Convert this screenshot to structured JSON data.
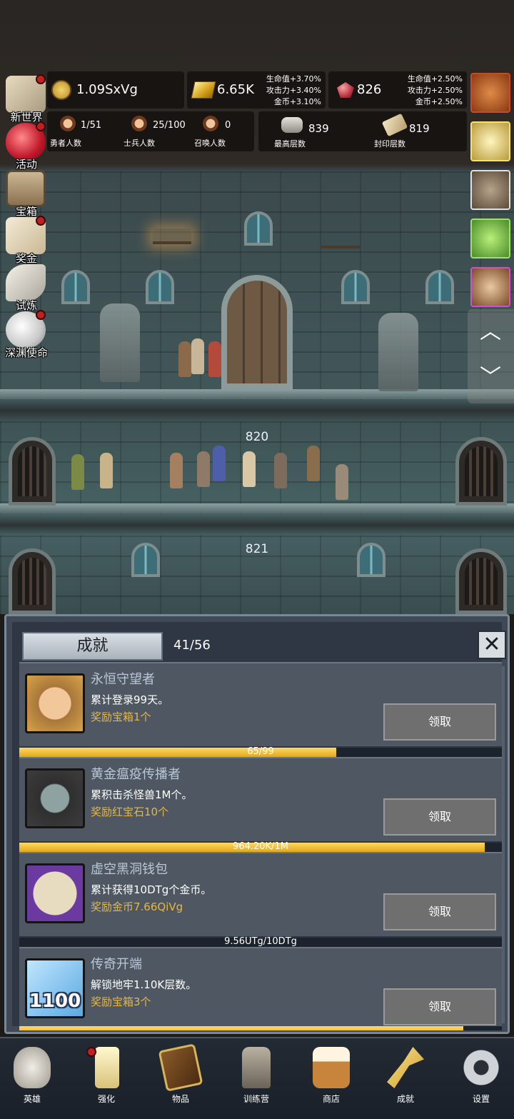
{
  "hud": {
    "coins": "1.09SxVg",
    "gold": "6.65K",
    "gold_bonuses": [
      "生命值+3.70%",
      "攻击力+3.40%",
      "金币+3.10%"
    ],
    "ruby": "826",
    "ruby_bonuses": [
      "生命值+2.50%",
      "攻击力+2.50%",
      "金币+2.50%"
    ],
    "stats": [
      {
        "value": "1/51",
        "label": "勇者人数"
      },
      {
        "value": "25/100",
        "label": "士兵人数"
      },
      {
        "value": "0",
        "label": "召唤人数"
      }
    ],
    "max_floor": {
      "value": "839",
      "label": "最高层数"
    },
    "sealed_floor": {
      "value": "819",
      "label": "封印层数"
    }
  },
  "left_menu": [
    {
      "label": "新世界",
      "icon": "map-icon",
      "badge": true
    },
    {
      "label": "活动",
      "icon": "heart-icon",
      "badge": true
    },
    {
      "label": "宝箱",
      "icon": "chest-icon",
      "badge": false
    },
    {
      "label": "奖金",
      "icon": "envelope-icon",
      "badge": true
    },
    {
      "label": "试炼",
      "icon": "feather-icon",
      "badge": false
    },
    {
      "label": "深渊使命",
      "icon": "orb-icon",
      "badge": true
    }
  ],
  "right_items": [
    "pumpkin-icon",
    "candle-icon",
    "backpack-icon",
    "slime-icon",
    "hero-portrait-icon"
  ],
  "floors": {
    "current": "820",
    "next": "821"
  },
  "achievements": {
    "title": "成就",
    "count": "41/56",
    "items": [
      {
        "title": "永恒守望者",
        "desc": "累计登录99天。",
        "reward": "奖励宝箱1个",
        "button": "领取",
        "progress_text": "65/99",
        "progress": 0.657,
        "icon": "hero-face-icon"
      },
      {
        "title": "黄金瘟疫传播者",
        "desc": "累积击杀怪兽1M个。",
        "reward": "奖励红宝石10个",
        "button": "领取",
        "progress_text": "964.20K/1M",
        "progress": 0.964,
        "icon": "hooded-monster-icon"
      },
      {
        "title": "虚空黑洞钱包",
        "desc": "累计获得10DTg个金币。",
        "reward": "奖励金币7.66QiVg",
        "button": "领取",
        "progress_text": "9.56UTg/10DTg",
        "progress": 0.0,
        "icon": "coin-icon"
      },
      {
        "title": "传奇开端",
        "desc": "解锁地牢1.10K层数。",
        "reward": "奖励宝箱3个",
        "button": "领取",
        "progress_text": "",
        "progress": 0.92,
        "icon": "map-1100-icon",
        "icon_text": "1100"
      }
    ]
  },
  "bottom_nav": [
    {
      "label": "英雄",
      "icon": "skull-icon",
      "badge": false
    },
    {
      "label": "强化",
      "icon": "candle-icon",
      "badge": true
    },
    {
      "label": "物品",
      "icon": "book-icon",
      "badge": false
    },
    {
      "label": "训练营",
      "icon": "lantern-icon",
      "badge": false
    },
    {
      "label": "商店",
      "icon": "beer-mug-icon",
      "badge": false
    },
    {
      "label": "成就",
      "icon": "key-icon",
      "badge": false
    },
    {
      "label": "设置",
      "icon": "gear-icon",
      "badge": false
    }
  ],
  "colors": {
    "progress": "#f0bf2a",
    "reward_text": "#e3b74a",
    "badge": "#c02020",
    "panel_bg": "#2e3743"
  }
}
